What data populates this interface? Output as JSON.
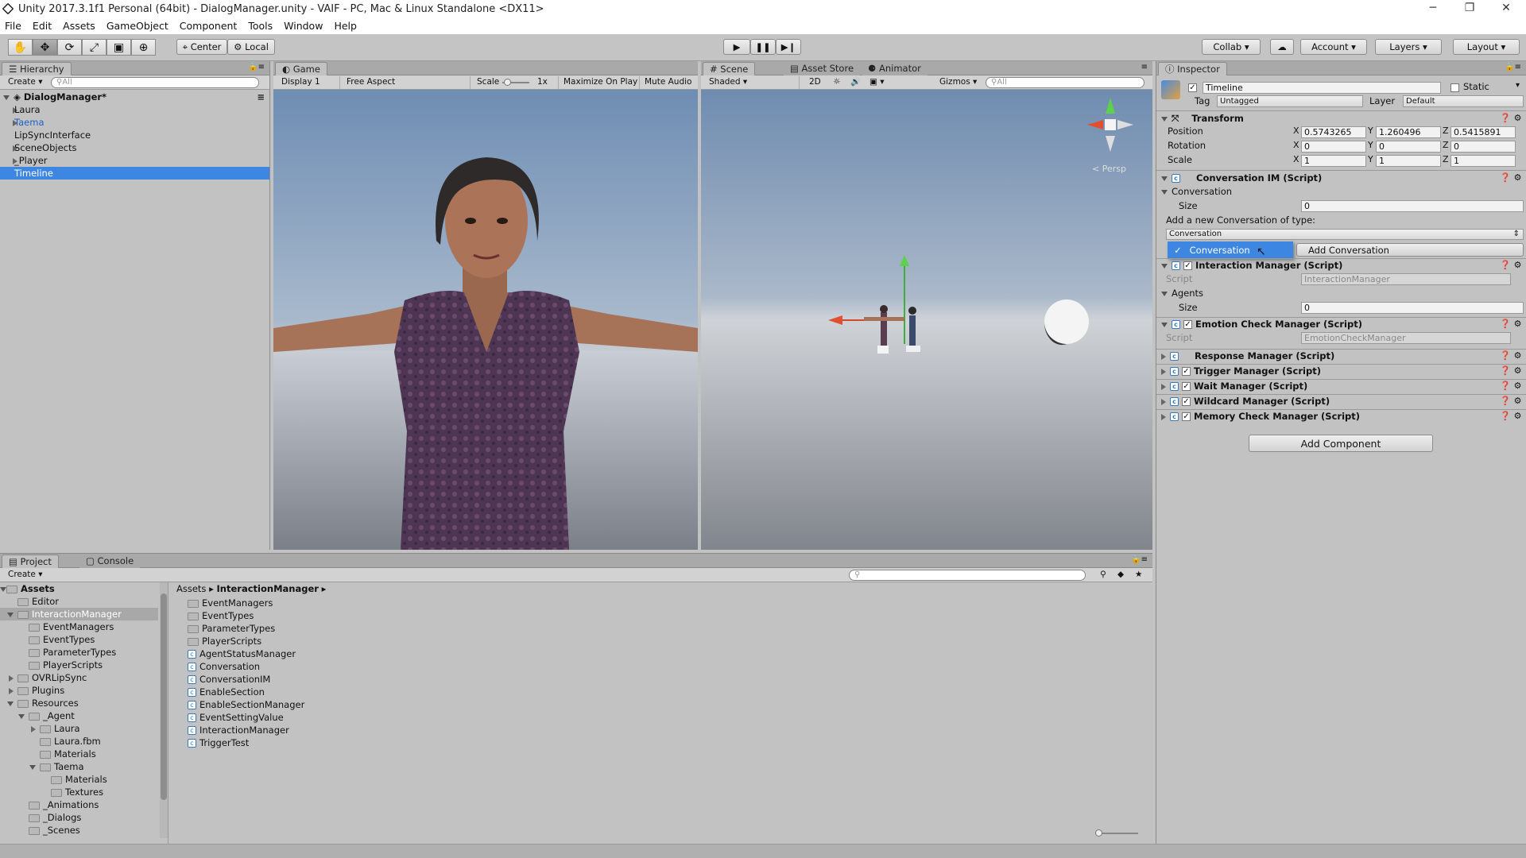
{
  "window": {
    "title": "Unity 2017.3.1f1 Personal (64bit) - DialogManager.unity - VAIF - PC, Mac & Linux Standalone <DX11>",
    "minimize": "─",
    "maximize": "❐",
    "close": "✕"
  },
  "menu": [
    "File",
    "Edit",
    "Assets",
    "GameObject",
    "Component",
    "Tools",
    "Window",
    "Help"
  ],
  "toolbar": {
    "pivot": "Center",
    "space": "Local",
    "collab": "Collab ▾",
    "account": "Account",
    "layers": "Layers",
    "layout": "Layout"
  },
  "hierarchy": {
    "tab": "Hierarchy",
    "create": "Create",
    "search": "All",
    "scene": "DialogManager*",
    "items": [
      {
        "label": "Laura",
        "expand": true,
        "color": "#111"
      },
      {
        "label": "Taema",
        "expand": true,
        "color": "#1f5fc7"
      },
      {
        "label": "LipSyncInterface",
        "expand": false,
        "color": "#111"
      },
      {
        "label": "SceneObjects",
        "expand": true,
        "color": "#111"
      },
      {
        "label": "_Player",
        "expand": true,
        "color": "#111"
      },
      {
        "label": "Timeline",
        "expand": false,
        "color": "#fff"
      }
    ],
    "selected": "Timeline"
  },
  "game": {
    "tab": "Game",
    "display": "Display 1",
    "aspect": "Free Aspect",
    "scale_label": "Scale",
    "scale_value": "1x",
    "maximize": "Maximize On Play",
    "mute": "Mute Audio"
  },
  "scene": {
    "tabs": [
      "Scene",
      "Asset Store",
      "Animator"
    ],
    "shading": "Shaded",
    "mode2d": "2D",
    "gizmos": "Gizmos",
    "search": "All",
    "persp": "< Persp"
  },
  "inspector": {
    "tab": "Inspector",
    "object_name": "Timeline",
    "static": "Static",
    "tag_label": "Tag",
    "tag": "Untagged",
    "layer_label": "Layer",
    "layer": "Default",
    "transform": {
      "title": "Transform",
      "position_label": "Position",
      "rotation_label": "Rotation",
      "scale_label": "Scale",
      "position": [
        "0.5743265",
        "1.260496",
        "0.5415891"
      ],
      "rotation": [
        "0",
        "0",
        "0"
      ],
      "scale": [
        "1",
        "1",
        "1"
      ],
      "axes": [
        "X",
        "Y",
        "Z"
      ]
    },
    "conversation_im": {
      "title": "Conversation IM (Script)",
      "conversation": "Conversation",
      "size_label": "Size",
      "size": "0",
      "add_label": "Add a new Conversation of type:",
      "type_value": "Conversation",
      "popup_item": "Conversation",
      "add_button": "Add Conversation"
    },
    "interaction_manager": {
      "title": "Interaction Manager (Script)",
      "script_label": "Script",
      "script": "InteractionManager",
      "agents": "Agents",
      "size_label": "Size",
      "size": "0"
    },
    "emotion_check": {
      "title": "Emotion Check Manager (Script)",
      "script_label": "Script",
      "script": "EmotionCheckManager"
    },
    "collapsed": [
      {
        "title": "Response Manager (Script)",
        "checked": false
      },
      {
        "title": "Trigger Manager (Script)",
        "checked": true
      },
      {
        "title": "Wait Manager (Script)",
        "checked": true
      },
      {
        "title": "Wildcard Manager (Script)",
        "checked": true
      },
      {
        "title": "Memory Check Manager (Script)",
        "checked": true
      }
    ],
    "add_component": "Add Component"
  },
  "project": {
    "tabs": [
      "Project",
      "Console"
    ],
    "create": "Create",
    "tree": [
      {
        "label": "Assets",
        "depth": 0,
        "arrow": "open",
        "bold": true
      },
      {
        "label": "Editor",
        "depth": 1,
        "arrow": "none"
      },
      {
        "label": "InteractionManager",
        "depth": 1,
        "arrow": "open",
        "sel": true
      },
      {
        "label": "EventManagers",
        "depth": 2,
        "arrow": "none"
      },
      {
        "label": "EventTypes",
        "depth": 2,
        "arrow": "none"
      },
      {
        "label": "ParameterTypes",
        "depth": 2,
        "arrow": "none"
      },
      {
        "label": "PlayerScripts",
        "depth": 2,
        "arrow": "none"
      },
      {
        "label": "OVRLipSync",
        "depth": 1,
        "arrow": "closed"
      },
      {
        "label": "Plugins",
        "depth": 1,
        "arrow": "closed"
      },
      {
        "label": "Resources",
        "depth": 1,
        "arrow": "open"
      },
      {
        "label": "_Agent",
        "depth": 2,
        "arrow": "open"
      },
      {
        "label": "Laura",
        "depth": 3,
        "arrow": "closed"
      },
      {
        "label": "Laura.fbm",
        "depth": 3,
        "arrow": "none"
      },
      {
        "label": "Materials",
        "depth": 3,
        "arrow": "none"
      },
      {
        "label": "Taema",
        "depth": 3,
        "arrow": "open"
      },
      {
        "label": "Materials",
        "depth": 4,
        "arrow": "none"
      },
      {
        "label": "Textures",
        "depth": 4,
        "arrow": "none"
      },
      {
        "label": "_Animations",
        "depth": 2,
        "arrow": "none"
      },
      {
        "label": "_Dialogs",
        "depth": 2,
        "arrow": "none"
      },
      {
        "label": "_Scenes",
        "depth": 2,
        "arrow": "none"
      }
    ],
    "breadcrumb": [
      "Assets",
      "InteractionManager"
    ],
    "files": [
      {
        "label": "EventManagers",
        "kind": "folder"
      },
      {
        "label": "EventTypes",
        "kind": "folder"
      },
      {
        "label": "ParameterTypes",
        "kind": "folder"
      },
      {
        "label": "PlayerScripts",
        "kind": "folder"
      },
      {
        "label": "AgentStatusManager",
        "kind": "script"
      },
      {
        "label": "Conversation",
        "kind": "script"
      },
      {
        "label": "ConversationIM",
        "kind": "script"
      },
      {
        "label": "EnableSection",
        "kind": "script"
      },
      {
        "label": "EnableSectionManager",
        "kind": "script"
      },
      {
        "label": "EventSettingValue",
        "kind": "script"
      },
      {
        "label": "InteractionManager",
        "kind": "script"
      },
      {
        "label": "TriggerTest",
        "kind": "script"
      }
    ]
  }
}
